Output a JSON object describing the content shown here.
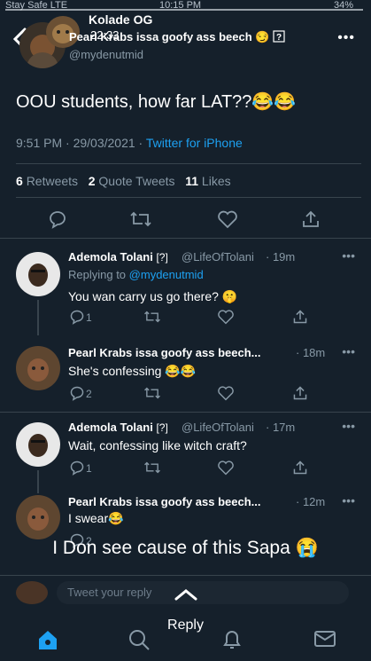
{
  "status_bar": {
    "carrier": "Stay Safe  LTE",
    "time": "10:15 PM",
    "battery": "34%"
  },
  "story": {
    "name": "Kolade OG",
    "time": "22:33"
  },
  "tweet": {
    "author_name": "Pearl Krabs issa goofy ass beech",
    "author_handle": "@mydenutmid",
    "text": "OOU students, how far LAT??",
    "emoji": "😂😂",
    "time": "9:51 PM · 29/03/2021 ·",
    "source": "Twitter for iPhone",
    "retweets_count": "6",
    "retweets_label": "Retweets",
    "quotes_count": "2",
    "quotes_label": "Quote Tweets",
    "likes_count": "11",
    "likes_label": "Likes"
  },
  "replies": [
    {
      "name": "Ademola Tolani",
      "handle": "@LifeOfTolani",
      "time": "· 19m",
      "replying_prefix": "Replying to",
      "replying_to": "@mydenutmid",
      "text": "You wan carry us go there? 🤫",
      "reply_count": "1"
    },
    {
      "name": "Pearl Krabs issa goofy ass beech...",
      "time": "· 18m",
      "text": "She's confessing 😂😂",
      "reply_count": "2"
    },
    {
      "name": "Ademola Tolani",
      "handle": "@LifeOfTolani",
      "time": "· 17m",
      "text": "Wait, confessing like witch craft?",
      "reply_count": "1"
    },
    {
      "name": "Pearl Krabs issa goofy ass beech...",
      "time": "· 12m",
      "text": "I swear😂",
      "reply_count": "2"
    }
  ],
  "overlay_caption": "I Don see  cause of this Sapa 😭",
  "compose_placeholder": "Tweet your reply",
  "story_reply_label": "Reply",
  "colors": {
    "background": "#15202b",
    "accent": "#1da1f2",
    "muted": "#8899a6",
    "divider": "#38444d"
  },
  "icons": [
    "back-icon",
    "more-icon",
    "reply-icon",
    "retweet-icon",
    "like-icon",
    "share-icon",
    "chevron-up-icon",
    "home-icon",
    "search-icon",
    "notifications-icon",
    "messages-icon"
  ]
}
